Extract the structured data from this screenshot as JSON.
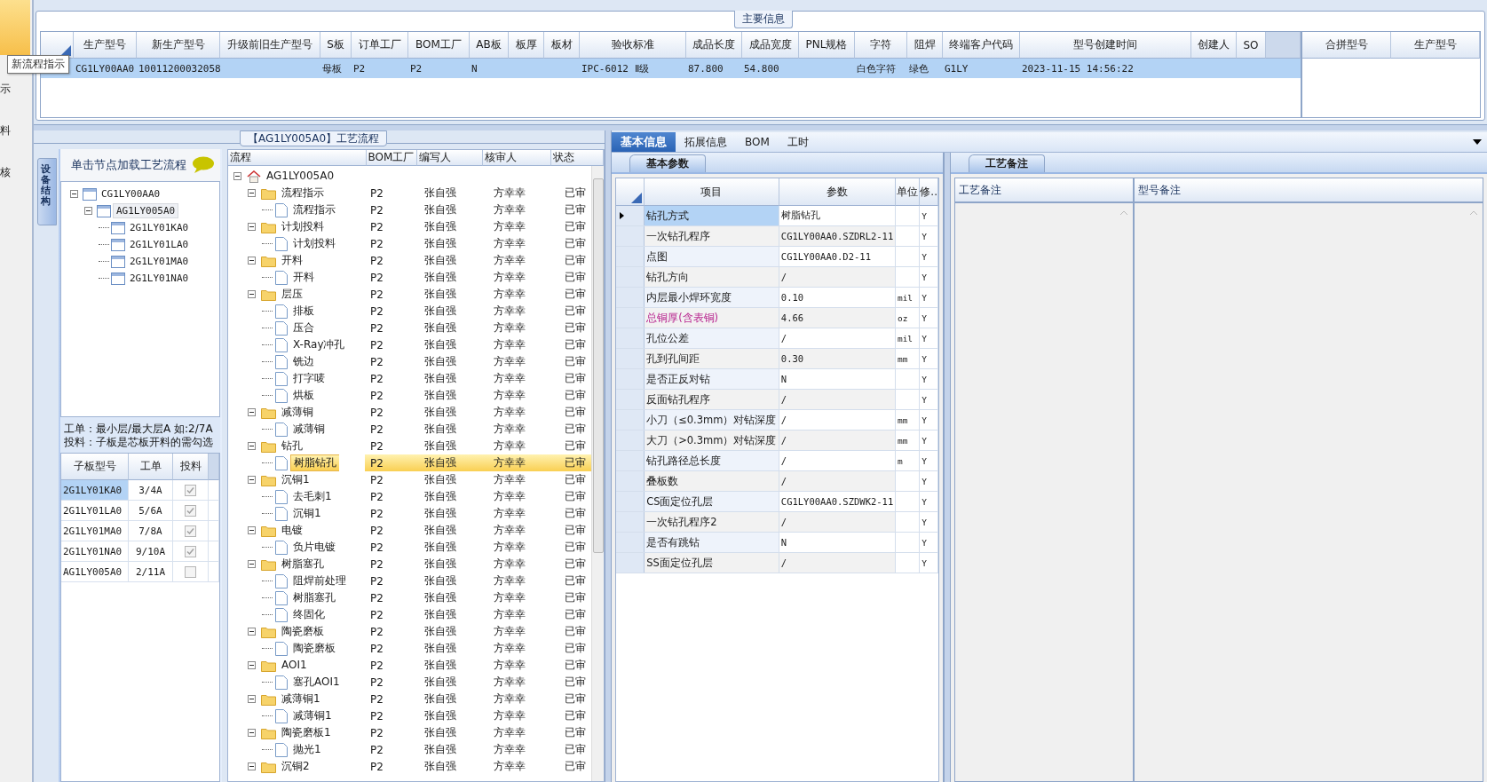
{
  "side_strip": {
    "items": [
      "示",
      "料",
      "核"
    ]
  },
  "tooltip": "新流程指示",
  "main_info": {
    "title": "主要信息",
    "columns": [
      {
        "label": "生产型号",
        "value": "CG1LY00AA0"
      },
      {
        "label": "新生产型号",
        "value": "10011200032058"
      },
      {
        "label": "升级前旧生产型号"
      },
      {
        "label": "S板",
        "value": "母板"
      },
      {
        "label": "订单工厂",
        "value": "P2"
      },
      {
        "label": "BOM工厂",
        "value": "P2"
      },
      {
        "label": "AB板",
        "value": "N"
      },
      {
        "label": "板厚"
      },
      {
        "label": "板材"
      },
      {
        "label": "验收标准",
        "value": "IPC-6012 Ⅱ级"
      },
      {
        "label": "成品长度",
        "value": "87.800"
      },
      {
        "label": "成品宽度",
        "value": "54.800"
      },
      {
        "label": "PNL规格"
      },
      {
        "label": "字符",
        "value": "白色字符"
      },
      {
        "label": "阻焊",
        "value": "绿色"
      },
      {
        "label": "终端客户代码",
        "value": "G1LY"
      },
      {
        "label": "型号创建时间",
        "value": "2023-11-15 14:56:22"
      },
      {
        "label": "创建人"
      },
      {
        "label": "SO"
      }
    ],
    "row": {
      "selected": true
    },
    "merge_table": {
      "columns": [
        "合拼型号",
        "生产型号"
      ]
    }
  },
  "structure_panel": {
    "tab": "设备结构",
    "header": "单击节点加载工艺流程",
    "tree": {
      "label": "CG1LY00AA0",
      "expanded": true,
      "selected": false,
      "children": [
        {
          "label": "AG1LY005A0",
          "expanded": true,
          "selected": true,
          "children": [
            {
              "label": "2G1LY01KA0",
              "selected": false
            },
            {
              "label": "2G1LY01LA0",
              "selected": false
            },
            {
              "label": "2G1LY01MA0",
              "selected": false
            },
            {
              "label": "2G1LY01NA0",
              "selected": false
            }
          ]
        }
      ]
    },
    "notes": [
      "工单：最小层/最大层A 如:2/7A",
      "投料：子板是芯板开料的需勾选"
    ],
    "sub_boards": {
      "columns": [
        "子板型号",
        "工单",
        "投料"
      ],
      "rows": [
        {
          "name": "2G1LY01KA0",
          "order": "3/4A",
          "feed": true,
          "selected": true
        },
        {
          "name": "2G1LY01LA0",
          "order": "5/6A",
          "feed": true,
          "selected": false
        },
        {
          "name": "2G1LY01MA0",
          "order": "7/8A",
          "feed": true,
          "selected": false
        },
        {
          "name": "2G1LY01NA0",
          "order": "9/10A",
          "feed": true,
          "selected": false
        },
        {
          "name": "AG1LY005A0",
          "order": "2/11A",
          "feed": false,
          "selected": false
        }
      ]
    }
  },
  "flow": {
    "title": "【AG1LY005A0】工艺流程",
    "columns": [
      "流程",
      "BOM工厂",
      "编写人",
      "核审人",
      "状态"
    ],
    "root": {
      "kind": "root",
      "label": "AG1LY005A0",
      "expanded": true,
      "selected": false,
      "children": [
        {
          "kind": "folder",
          "label": "流程指示",
          "bom": "P2",
          "writer": "张自强",
          "reviewer": "方幸幸",
          "status": "已审",
          "expanded": true,
          "selected": false,
          "children": [
            {
              "kind": "step",
              "label": "流程指示",
              "bom": "P2",
              "writer": "张自强",
              "reviewer": "方幸幸",
              "status": "已审",
              "selected": false
            }
          ]
        },
        {
          "kind": "folder",
          "label": "计划投料",
          "bom": "P2",
          "writer": "张自强",
          "reviewer": "方幸幸",
          "status": "已审",
          "expanded": true,
          "selected": false,
          "children": [
            {
              "kind": "step",
              "label": "计划投料",
              "bom": "P2",
              "writer": "张自强",
              "reviewer": "方幸幸",
              "status": "已审",
              "selected": false
            }
          ]
        },
        {
          "kind": "folder",
          "label": "开料",
          "bom": "P2",
          "writer": "张自强",
          "reviewer": "方幸幸",
          "status": "已审",
          "expanded": true,
          "selected": false,
          "children": [
            {
              "kind": "step",
              "label": "开料",
              "bom": "P2",
              "writer": "张自强",
              "reviewer": "方幸幸",
              "status": "已审",
              "selected": false
            }
          ]
        },
        {
          "kind": "folder",
          "label": "层压",
          "bom": "P2",
          "writer": "张自强",
          "reviewer": "方幸幸",
          "status": "已审",
          "expanded": true,
          "selected": false,
          "children": [
            {
              "kind": "step",
              "label": "排板",
              "bom": "P2",
              "writer": "张自强",
              "reviewer": "方幸幸",
              "status": "已审",
              "selected": false
            },
            {
              "kind": "step",
              "label": "压合",
              "bom": "P2",
              "writer": "张自强",
              "reviewer": "方幸幸",
              "status": "已审",
              "selected": false
            },
            {
              "kind": "step",
              "label": "X-Ray冲孔",
              "bom": "P2",
              "writer": "张自强",
              "reviewer": "方幸幸",
              "status": "已审",
              "selected": false
            },
            {
              "kind": "step",
              "label": "铣边",
              "bom": "P2",
              "writer": "张自强",
              "reviewer": "方幸幸",
              "status": "已审",
              "selected": false
            },
            {
              "kind": "step",
              "label": "打字唛",
              "bom": "P2",
              "writer": "张自强",
              "reviewer": "方幸幸",
              "status": "已审",
              "selected": false
            },
            {
              "kind": "step",
              "label": "烘板",
              "bom": "P2",
              "writer": "张自强",
              "reviewer": "方幸幸",
              "status": "已审",
              "selected": false
            }
          ]
        },
        {
          "kind": "folder",
          "label": "减薄铜",
          "bom": "P2",
          "writer": "张自强",
          "reviewer": "方幸幸",
          "status": "已审",
          "expanded": true,
          "selected": false,
          "children": [
            {
              "kind": "step",
              "label": "减薄铜",
              "bom": "P2",
              "writer": "张自强",
              "reviewer": "方幸幸",
              "status": "已审",
              "selected": false
            }
          ]
        },
        {
          "kind": "folder",
          "label": "钻孔",
          "bom": "P2",
          "writer": "张自强",
          "reviewer": "方幸幸",
          "status": "已审",
          "expanded": true,
          "selected": false,
          "children": [
            {
              "kind": "step",
              "label": "树脂钻孔",
              "bom": "P2",
              "writer": "张自强",
              "reviewer": "方幸幸",
              "status": "已审",
              "selected": true
            }
          ]
        },
        {
          "kind": "folder",
          "label": "沉铜1",
          "bom": "P2",
          "writer": "张自强",
          "reviewer": "方幸幸",
          "status": "已审",
          "expanded": true,
          "selected": false,
          "children": [
            {
              "kind": "step",
              "label": "去毛刺1",
              "bom": "P2",
              "writer": "张自强",
              "reviewer": "方幸幸",
              "status": "已审",
              "selected": false
            },
            {
              "kind": "step",
              "label": "沉铜1",
              "bom": "P2",
              "writer": "张自强",
              "reviewer": "方幸幸",
              "status": "已审",
              "selected": false
            }
          ]
        },
        {
          "kind": "folder",
          "label": "电镀",
          "bom": "P2",
          "writer": "张自强",
          "reviewer": "方幸幸",
          "status": "已审",
          "expanded": true,
          "selected": false,
          "children": [
            {
              "kind": "step",
              "label": "负片电镀",
              "bom": "P2",
              "writer": "张自强",
              "reviewer": "方幸幸",
              "status": "已审",
              "selected": false
            }
          ]
        },
        {
          "kind": "folder",
          "label": "树脂塞孔",
          "bom": "P2",
          "writer": "张自强",
          "reviewer": "方幸幸",
          "status": "已审",
          "expanded": true,
          "selected": false,
          "children": [
            {
              "kind": "step",
              "label": "阻焊前处理",
              "bom": "P2",
              "writer": "张自强",
              "reviewer": "方幸幸",
              "status": "已审",
              "selected": false
            },
            {
              "kind": "step",
              "label": "树脂塞孔",
              "bom": "P2",
              "writer": "张自强",
              "reviewer": "方幸幸",
              "status": "已审",
              "selected": false
            },
            {
              "kind": "step",
              "label": "终固化",
              "bom": "P2",
              "writer": "张自强",
              "reviewer": "方幸幸",
              "status": "已审",
              "selected": false
            }
          ]
        },
        {
          "kind": "folder",
          "label": "陶瓷磨板",
          "bom": "P2",
          "writer": "张自强",
          "reviewer": "方幸幸",
          "status": "已审",
          "expanded": true,
          "selected": false,
          "children": [
            {
              "kind": "step",
              "label": "陶瓷磨板",
              "bom": "P2",
              "writer": "张自强",
              "reviewer": "方幸幸",
              "status": "已审",
              "selected": false
            }
          ]
        },
        {
          "kind": "folder",
          "label": "AOI1",
          "bom": "P2",
          "writer": "张自强",
          "reviewer": "方幸幸",
          "status": "已审",
          "expanded": true,
          "selected": false,
          "children": [
            {
              "kind": "step",
              "label": "塞孔AOI1",
              "bom": "P2",
              "writer": "张自强",
              "reviewer": "方幸幸",
              "status": "已审",
              "selected": false
            }
          ]
        },
        {
          "kind": "folder",
          "label": "减薄铜1",
          "bom": "P2",
          "writer": "张自强",
          "reviewer": "方幸幸",
          "status": "已审",
          "expanded": true,
          "selected": false,
          "children": [
            {
              "kind": "step",
              "label": "减薄铜1",
              "bom": "P2",
              "writer": "张自强",
              "reviewer": "方幸幸",
              "status": "已审",
              "selected": false
            }
          ]
        },
        {
          "kind": "folder",
          "label": "陶瓷磨板1",
          "bom": "P2",
          "writer": "张自强",
          "reviewer": "方幸幸",
          "status": "已审",
          "expanded": true,
          "selected": false,
          "children": [
            {
              "kind": "step",
              "label": "抛光1",
              "bom": "P2",
              "writer": "张自强",
              "reviewer": "方幸幸",
              "status": "已审",
              "selected": false
            }
          ]
        },
        {
          "kind": "folder",
          "label": "沉铜2",
          "bom": "P2",
          "writer": "张自强",
          "reviewer": "方幸幸",
          "status": "已审",
          "expanded": true,
          "selected": false
        }
      ]
    }
  },
  "detail": {
    "tabs": [
      {
        "label": "基本信息",
        "selected": true
      },
      {
        "label": "拓展信息",
        "selected": false
      },
      {
        "label": "BOM",
        "selected": false
      },
      {
        "label": "工时",
        "selected": false
      }
    ],
    "params": {
      "tab": "基本参数",
      "columns": [
        "项目",
        "参数",
        "单位",
        "修.."
      ],
      "rows": [
        {
          "item": "钻孔方式",
          "value": "树脂钻孔",
          "mod": "Y",
          "warning": false,
          "selected": true
        },
        {
          "item": "一次钻孔程序",
          "value": "CG1LY00AA0.SZDRL2-11",
          "mod": "Y",
          "warning": false,
          "selected": false
        },
        {
          "item": "点图",
          "value": "CG1LY00AA0.D2-11",
          "mod": "Y",
          "warning": false,
          "selected": false
        },
        {
          "item": "钻孔方向",
          "value": "/",
          "mod": "Y",
          "warning": false,
          "selected": false
        },
        {
          "item": "内层最小焊环宽度",
          "value": "0.10",
          "unit": "mil",
          "mod": "Y",
          "warning": false,
          "selected": false
        },
        {
          "item": "总铜厚(含表铜)",
          "value": "4.66",
          "unit": "oz",
          "mod": "Y",
          "warning": true,
          "selected": false
        },
        {
          "item": "孔位公差",
          "value": "/",
          "unit": "mil",
          "mod": "Y",
          "warning": false,
          "selected": false
        },
        {
          "item": "孔到孔间距",
          "value": "0.30",
          "unit": "mm",
          "mod": "Y",
          "warning": false,
          "selected": false
        },
        {
          "item": "是否正反对钻",
          "value": "N",
          "mod": "Y",
          "warning": false,
          "selected": false
        },
        {
          "item": "反面钻孔程序",
          "value": "/",
          "mod": "Y",
          "warning": false,
          "selected": false
        },
        {
          "item": "小刀（≤0.3mm）对钻深度",
          "value": "/",
          "unit": "mm",
          "mod": "Y",
          "warning": false,
          "selected": false
        },
        {
          "item": "大刀（>0.3mm）对钻深度",
          "value": "/",
          "unit": "mm",
          "mod": "Y",
          "warning": false,
          "selected": false
        },
        {
          "item": "钻孔路径总长度",
          "value": "/",
          "unit": "m",
          "mod": "Y",
          "warning": false,
          "selected": false
        },
        {
          "item": "叠板数",
          "value": "/",
          "mod": "Y",
          "warning": false,
          "selected": false
        },
        {
          "item": "CS面定位孔层",
          "value": "CG1LY00AA0.SZDWK2-11",
          "mod": "Y",
          "warning": false,
          "selected": false
        },
        {
          "item": "一次钻孔程序2",
          "value": "/",
          "mod": "Y",
          "warning": false,
          "selected": false
        },
        {
          "item": "是否有跳钻",
          "value": "N",
          "mod": "Y",
          "warning": false,
          "selected": false
        },
        {
          "item": "SS面定位孔层",
          "value": "/",
          "mod": "Y",
          "warning": false,
          "selected": false
        }
      ]
    },
    "remarks": {
      "tab": "工艺备注",
      "columns": [
        "工艺备注",
        "型号备注"
      ]
    }
  }
}
